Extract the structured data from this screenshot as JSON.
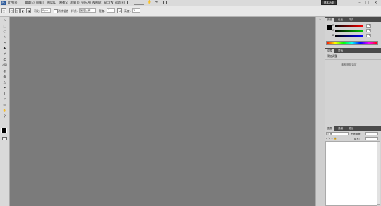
{
  "menubar": {
    "items": [
      "文件(F)",
      "编辑(E)",
      "图像(I)",
      "图层(L)",
      "选择(S)",
      "滤镜(T)",
      "分析(A)",
      "视图(V)",
      "窗口(W)",
      "帮助(H)"
    ],
    "brand_label": "基本功能",
    "minimize": "–",
    "maximize": "□",
    "close": "×"
  },
  "optbar": {
    "feather_label": "羽化:",
    "feather_value": "0 px",
    "antialias_label": "消除锯齿",
    "style_label": "样式:",
    "style_value": "固定比例",
    "width_label": "宽度:",
    "width_value": "1",
    "height_label": "高度:",
    "height_value": "1"
  },
  "tools": [
    "↖",
    "⬚",
    "◌",
    "✎",
    "⌗",
    "✚",
    "✐",
    "⎚",
    "⌫",
    "◐",
    "◍",
    "△",
    "✒",
    "T",
    "↗",
    "▭",
    "✋",
    "⚲"
  ],
  "color_panel": {
    "tabs": [
      "颜色",
      "色板",
      "样式"
    ],
    "channels": [
      {
        "label": "R",
        "value": "0",
        "color": "#d23a2a"
      },
      {
        "label": "G",
        "value": "0",
        "color": "#3aa33a"
      },
      {
        "label": "B",
        "value": "0",
        "color": "#2a4fd2"
      }
    ]
  },
  "adjust_panel": {
    "tabs": [
      "调整",
      "蒙版"
    ],
    "heading": "添加调整",
    "message": "未检测到选区"
  },
  "layers_panel": {
    "tabs": [
      "图层",
      "通道",
      "路径"
    ],
    "mode_value": "正常",
    "opacity_label": "不透明度:",
    "fill_label": "填充:"
  },
  "colors": {
    "canvas": "#7b7b7b",
    "panel": "#d3d3d3",
    "tabbar": "#4a4a4a"
  }
}
